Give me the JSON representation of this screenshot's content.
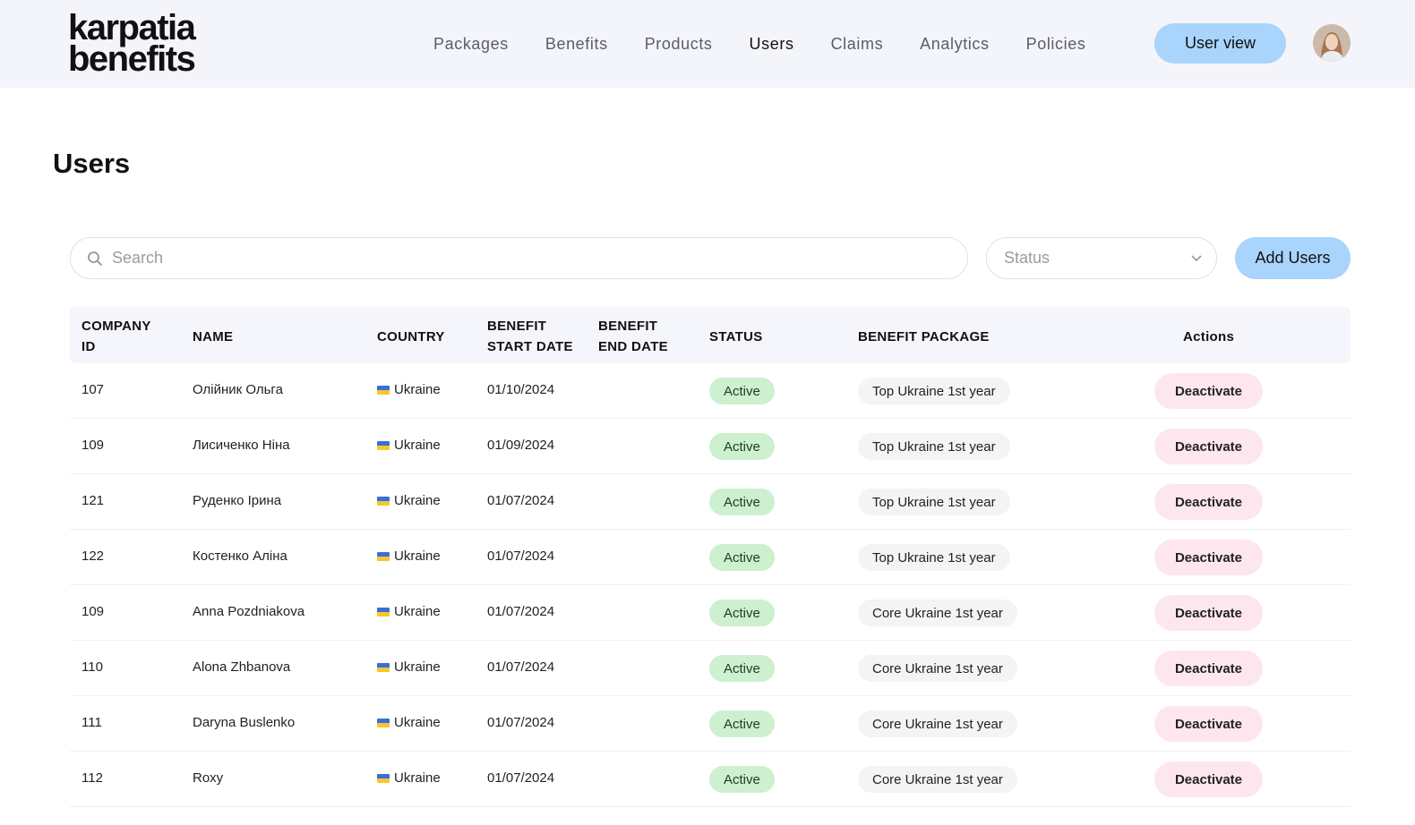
{
  "brand": {
    "line1": "karpatia",
    "line2": "benefits"
  },
  "nav": {
    "items": [
      "Packages",
      "Benefits",
      "Products",
      "Users",
      "Claims",
      "Analytics",
      "Policies"
    ],
    "active": "Users",
    "user_view_label": "User view"
  },
  "page": {
    "title": "Users"
  },
  "toolbar": {
    "search_placeholder": "Search",
    "status_placeholder": "Status",
    "add_users_label": "Add Users"
  },
  "table": {
    "headers": {
      "company_id_1": "COMPANY",
      "company_id_2": "ID",
      "name": "NAME",
      "country": "COUNTRY",
      "start_1": "BENEFIT",
      "start_2": "START DATE",
      "end_1": "BENEFIT",
      "end_2": "END DATE",
      "status": "STATUS",
      "package": "BENEFIT PACKAGE",
      "actions": "Actions"
    },
    "rows": [
      {
        "id": "107",
        "name": "Олійник Ольга",
        "country": "Ukraine",
        "start": "01/10/2024",
        "end": "",
        "status": "Active",
        "package": "Top Ukraine 1st year",
        "action": "Deactivate"
      },
      {
        "id": "109",
        "name": "Лисиченко Ніна",
        "country": "Ukraine",
        "start": "01/09/2024",
        "end": "",
        "status": "Active",
        "package": "Top Ukraine 1st year",
        "action": "Deactivate"
      },
      {
        "id": "121",
        "name": "Руденко Ірина",
        "country": "Ukraine",
        "start": "01/07/2024",
        "end": "",
        "status": "Active",
        "package": "Top Ukraine 1st year",
        "action": "Deactivate"
      },
      {
        "id": "122",
        "name": "Костенко Аліна",
        "country": "Ukraine",
        "start": "01/07/2024",
        "end": "",
        "status": "Active",
        "package": "Top Ukraine 1st year",
        "action": "Deactivate"
      },
      {
        "id": "109",
        "name": "Anna Pozdniakova",
        "country": "Ukraine",
        "start": "01/07/2024",
        "end": "",
        "status": "Active",
        "package": "Core Ukraine 1st year",
        "action": "Deactivate"
      },
      {
        "id": "110",
        "name": "Alona Zhbanova",
        "country": "Ukraine",
        "start": "01/07/2024",
        "end": "",
        "status": "Active",
        "package": "Core Ukraine 1st year",
        "action": "Deactivate"
      },
      {
        "id": "111",
        "name": "Daryna Buslenko",
        "country": "Ukraine",
        "start": "01/07/2024",
        "end": "",
        "status": "Active",
        "package": "Core Ukraine 1st year",
        "action": "Deactivate"
      },
      {
        "id": "112",
        "name": "Roxy",
        "country": "Ukraine",
        "start": "01/07/2024",
        "end": "",
        "status": "Active",
        "package": "Core Ukraine 1st year",
        "action": "Deactivate"
      }
    ]
  },
  "colors": {
    "header_bg": "#f4f5fb",
    "primary_button": "#a9d4fb",
    "status_active_bg": "#cdf0cf",
    "deactivate_bg": "#fde6ee",
    "package_pill_bg": "#f4f4f7"
  },
  "icons": {
    "search": "search-icon",
    "status_dropdown": "chevron-down-icon",
    "flag": "ukraine-flag-icon"
  }
}
